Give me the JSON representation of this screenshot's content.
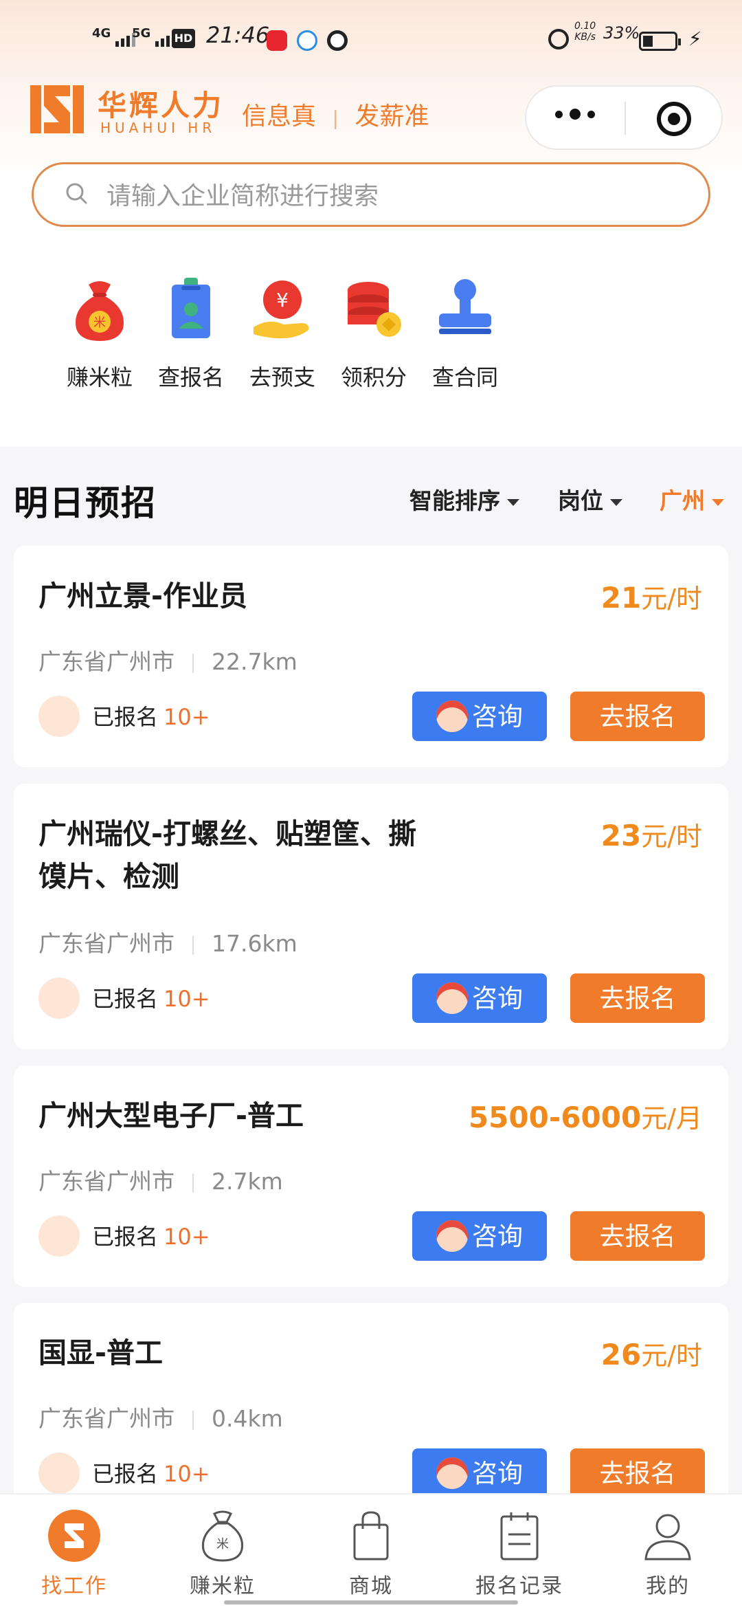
{
  "status_bar": {
    "network1": "4G",
    "network2": "5G",
    "hd": "HD",
    "time": "21:46",
    "speed_value": "0.10",
    "speed_unit": "KB/s",
    "battery": "33%"
  },
  "header": {
    "brand_cn": "华辉人力",
    "brand_en": "HUAHUI HR",
    "slogan_1": "信息真",
    "slogan_sep": "|",
    "slogan_2": "发薪准"
  },
  "search": {
    "placeholder": "请输入企业简称进行搜索"
  },
  "quick_menu": [
    {
      "label": "赚米粒",
      "icon": "money-bag-icon"
    },
    {
      "label": "查报名",
      "icon": "badge-icon"
    },
    {
      "label": "去预支",
      "icon": "yuan-hand-icon"
    },
    {
      "label": "领积分",
      "icon": "coins-stack-icon"
    },
    {
      "label": "查合同",
      "icon": "stamp-icon"
    }
  ],
  "section": {
    "title": "明日预招",
    "filters": [
      "智能排序",
      "岗位",
      "广州"
    ],
    "active_filter": "广州",
    "accent_color": "#f07b2b"
  },
  "jobs": [
    {
      "title": "广州立景-作业员",
      "salary_amount": "21",
      "salary_unit": "元/时",
      "location": "广东省广州市",
      "distance": "22.7km",
      "signed_label": "已报名",
      "signed_count": "10+",
      "consult_label": "咨询",
      "apply_label": "去报名"
    },
    {
      "title": "广州瑞仪-打螺丝、贴塑筐、撕馍片、检测",
      "salary_amount": "23",
      "salary_unit": "元/时",
      "location": "广东省广州市",
      "distance": "17.6km",
      "signed_label": "已报名",
      "signed_count": "10+",
      "consult_label": "咨询",
      "apply_label": "去报名"
    },
    {
      "title": "广州大型电子厂-普工",
      "salary_amount": "5500-6000",
      "salary_unit": "元/月",
      "location": "广东省广州市",
      "distance": "2.7km",
      "signed_label": "已报名",
      "signed_count": "10+",
      "consult_label": "咨询",
      "apply_label": "去报名"
    },
    {
      "title": "国显-普工",
      "salary_amount": "26",
      "salary_unit": "元/时",
      "location": "广东省广州市",
      "distance": "0.4km",
      "signed_label": "已报名",
      "signed_count": "10+",
      "consult_label": "咨询",
      "apply_label": "去报名"
    }
  ],
  "tabbar": [
    {
      "label": "找工作",
      "icon": "find-job-icon",
      "active": true
    },
    {
      "label": "赚米粒",
      "icon": "money-bag-icon",
      "active": false
    },
    {
      "label": "商城",
      "icon": "shopping-bag-icon",
      "active": false
    },
    {
      "label": "报名记录",
      "icon": "calendar-icon",
      "active": false
    },
    {
      "label": "我的",
      "icon": "user-icon",
      "active": false
    }
  ]
}
